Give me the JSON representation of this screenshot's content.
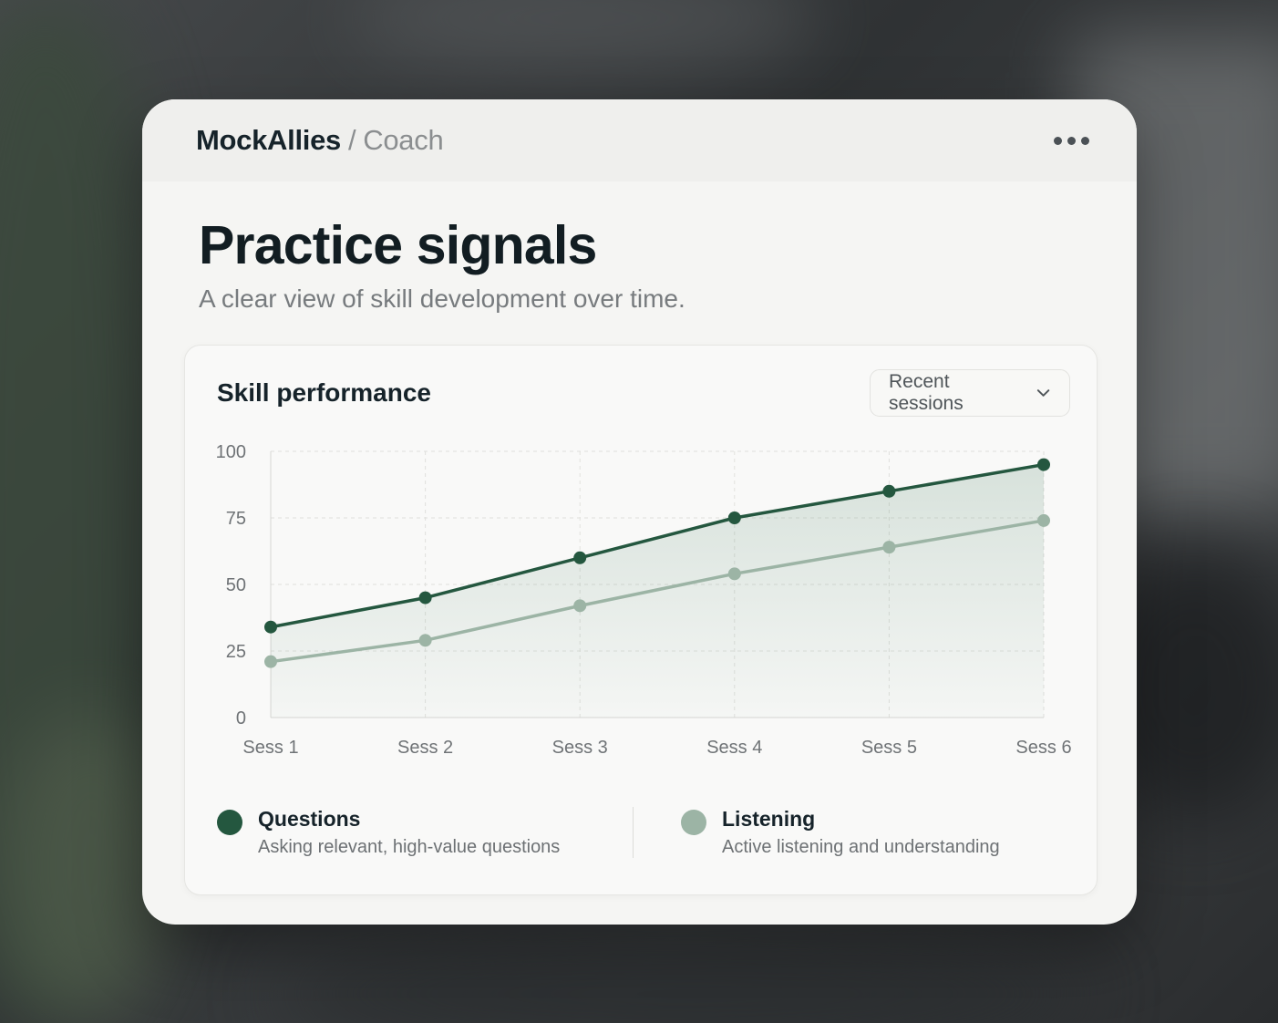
{
  "app": {
    "brand": "MockAllies",
    "separator": "/",
    "page": "Coach"
  },
  "header": {
    "title": "Practice signals",
    "subtitle": "A clear view of skill development over time."
  },
  "panel": {
    "title": "Skill performance",
    "dropdown": {
      "selected": "Recent sessions",
      "icon": "chevron-down-icon"
    }
  },
  "chart_data": {
    "type": "line",
    "categories": [
      "Sess 1",
      "Sess 2",
      "Sess 3",
      "Sess 4",
      "Sess 5",
      "Sess 6"
    ],
    "series": [
      {
        "name": "Questions",
        "values": [
          34,
          45,
          60,
          75,
          85,
          95
        ],
        "color": "#24573f"
      },
      {
        "name": "Listening",
        "values": [
          21,
          29,
          42,
          54,
          64,
          74
        ],
        "color": "#9cb4a5"
      }
    ],
    "yticks": [
      "0",
      "25",
      "50",
      "75",
      "100"
    ],
    "ylim": [
      0,
      100
    ],
    "grid": true,
    "legend_placement": "bottom"
  },
  "legend": [
    {
      "name": "Questions",
      "description": "Asking relevant, high-value questions",
      "color": "#24573f"
    },
    {
      "name": "Listening",
      "description": "Active listening and understanding",
      "color": "#9cb4a5"
    }
  ]
}
